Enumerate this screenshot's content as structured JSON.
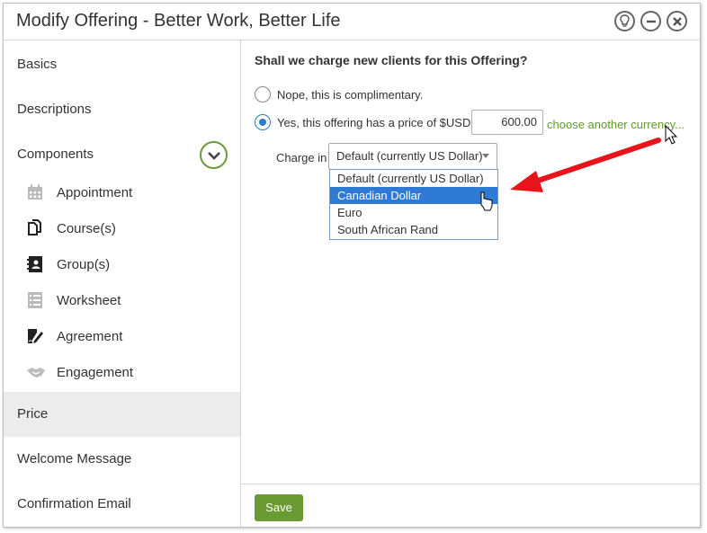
{
  "window": {
    "title": "Modify Offering - Better Work, Better Life",
    "buttons": [
      {
        "icon": "lightbulb-icon"
      },
      {
        "icon": "minimize-icon"
      },
      {
        "icon": "close-icon"
      }
    ]
  },
  "sidebar": {
    "items": [
      {
        "label": "Basics"
      },
      {
        "label": "Descriptions"
      },
      {
        "label": "Components",
        "expanded": true
      },
      {
        "label": "Price",
        "active": true
      },
      {
        "label": "Welcome Message"
      },
      {
        "label": "Confirmation Email"
      }
    ],
    "components": [
      {
        "label": "Appointment",
        "icon": "calendar-icon"
      },
      {
        "label": "Course(s)",
        "icon": "copy-icon"
      },
      {
        "label": "Group(s)",
        "icon": "contacts-book-icon"
      },
      {
        "label": "Worksheet",
        "icon": "list-icon"
      },
      {
        "label": "Agreement",
        "icon": "sign-document-icon"
      },
      {
        "label": "Engagement",
        "icon": "handshake-icon"
      }
    ]
  },
  "price": {
    "question": "Shall we charge new clients for this Offering?",
    "option_free": "Nope, this is complimentary.",
    "option_paid": "Yes, this offering has a price of $USD",
    "selected": "paid",
    "amount": "600.00",
    "currency_link": "choose another currency...",
    "charge_in_label": "Charge in",
    "charge_in_value": "Default (currently US Dollar)",
    "currency_options": [
      "Default (currently US Dollar)",
      "Canadian Dollar",
      "Euro",
      "South African Rand"
    ],
    "highlighted_option": "Canadian Dollar"
  },
  "footer": {
    "save_label": "Save"
  },
  "colors": {
    "accent_green": "#6a9a32",
    "link_green": "#5f9a2e",
    "select_blue": "#2f7bd3",
    "annotation_red": "#e8141b"
  }
}
